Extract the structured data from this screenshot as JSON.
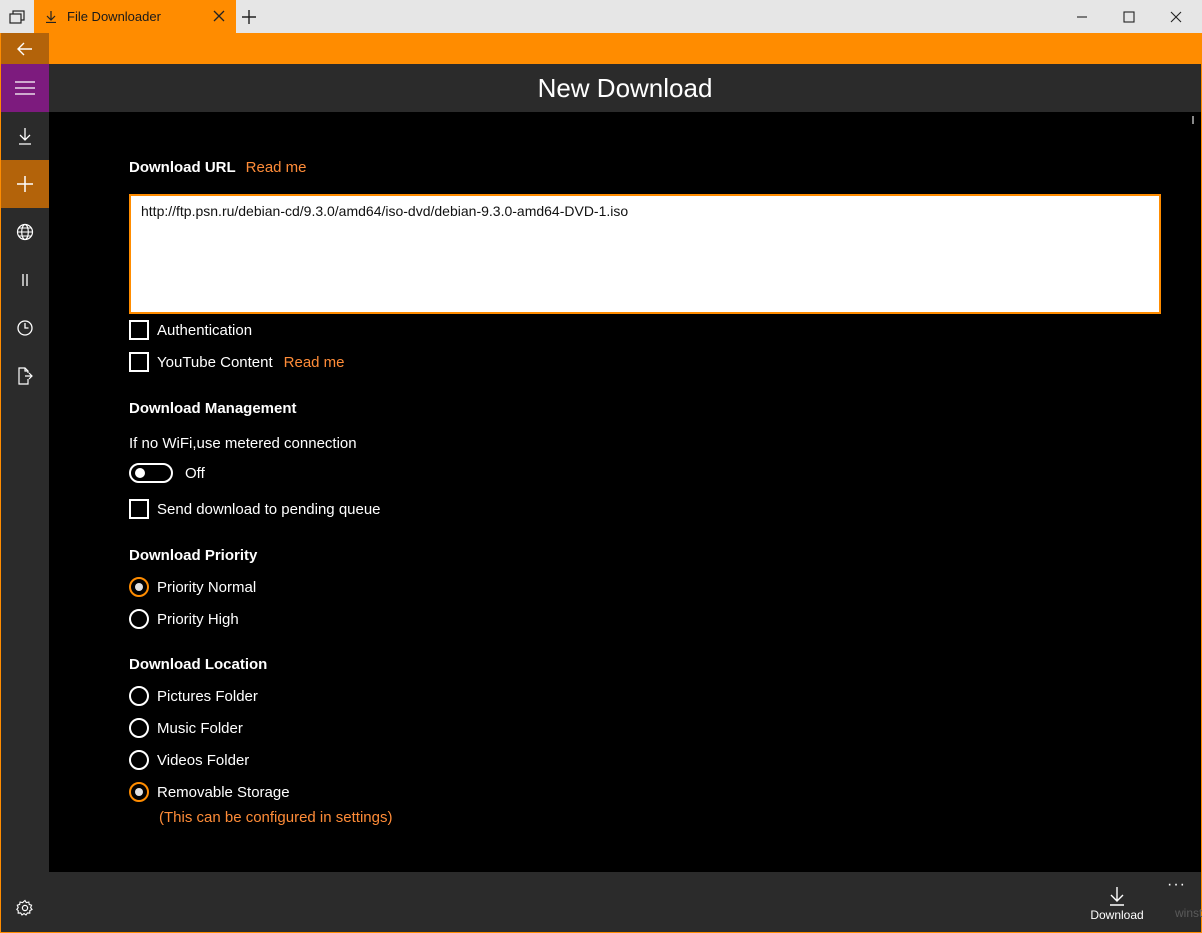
{
  "titlebar": {
    "tab_title": "File Downloader",
    "taskview_icon": "task-view-icon",
    "new_tab_icon": "plus-icon",
    "controls": [
      "minimize-icon",
      "maximize-icon",
      "close-icon"
    ]
  },
  "accent_color": "#ff8c00",
  "nav": {
    "items": [
      "back-arrow-icon",
      "hamburger-icon",
      "download-icon",
      "add-icon",
      "globe-icon",
      "pause-icon",
      "history-icon",
      "file-export-icon",
      "settings-icon"
    ],
    "active": "add-icon"
  },
  "page": {
    "title": "New Download"
  },
  "form": {
    "url_label": "Download URL",
    "url_readme": "Read me",
    "url_value": "http://ftp.psn.ru/debian-cd/9.3.0/amd64/iso-dvd/debian-9.3.0-amd64-DVD-1.iso",
    "authentication_label": "Authentication",
    "authentication_checked": false,
    "youtube_label": "YouTube Content",
    "youtube_readme": "Read me",
    "youtube_checked": false,
    "management_heading": "Download Management",
    "metered_label": "If no WiFi,use metered connection",
    "metered_state": "Off",
    "pending_label": "Send download to pending queue",
    "pending_checked": false,
    "priority_heading": "Download Priority",
    "priority_options": [
      "Priority Normal",
      "Priority High"
    ],
    "priority_selected": "Priority Normal",
    "location_heading": "Download Location",
    "location_options": [
      "Pictures Folder",
      "Music Folder",
      "Videos Folder",
      "Removable Storage"
    ],
    "location_selected": "Removable Storage",
    "location_note": "(This can be configured in settings)"
  },
  "commandbar": {
    "download_label": "Download",
    "more_label": "···",
    "watermark": "winstart.ru"
  }
}
